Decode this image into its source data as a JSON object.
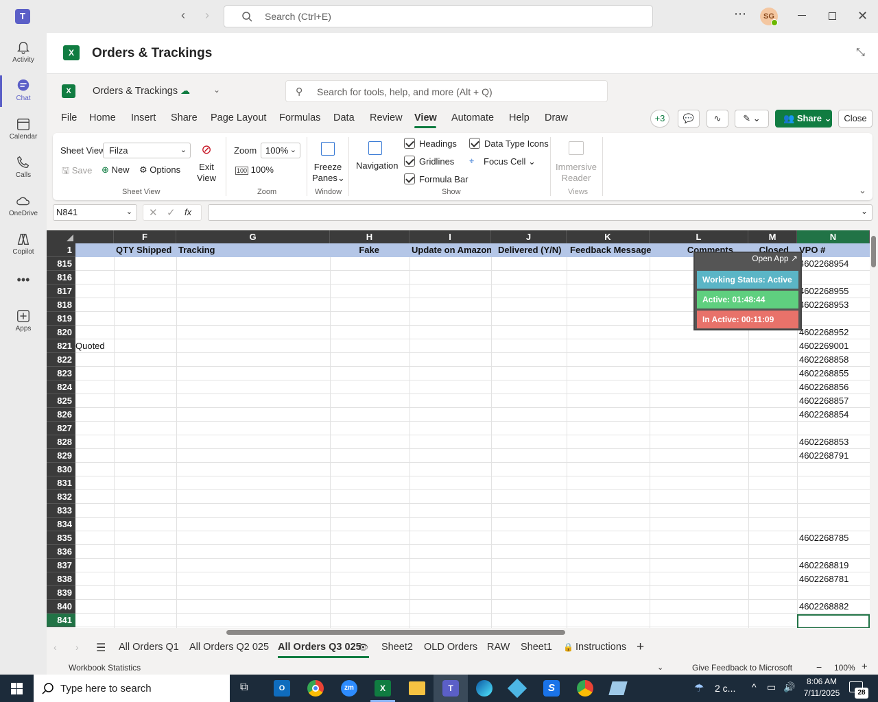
{
  "titlebar": {
    "search_placeholder": "Search (Ctrl+E)",
    "avatar_initials": "SG"
  },
  "rail": [
    {
      "label": "Activity",
      "icon": "bell-icon"
    },
    {
      "label": "Chat",
      "icon": "chat-icon"
    },
    {
      "label": "Calendar",
      "icon": "calendar-icon"
    },
    {
      "label": "Calls",
      "icon": "phone-icon"
    },
    {
      "label": "OneDrive",
      "icon": "cloud-icon"
    },
    {
      "label": "Copilot",
      "icon": "copilot-icon"
    },
    {
      "label": "",
      "icon": "more-icon"
    },
    {
      "label": "Apps",
      "icon": "add-apps-icon"
    }
  ],
  "app_header": {
    "title": "Orders & Trackings"
  },
  "excel": {
    "doc_name": "Orders & Trackings",
    "search_placeholder": "Search for tools, help, and more (Alt + Q)",
    "menu": [
      "File",
      "Home",
      "Insert",
      "Share",
      "Page Layout",
      "Formulas",
      "Data",
      "Review",
      "View",
      "Automate",
      "Help",
      "Draw"
    ],
    "active_menu": "View",
    "presence_count": "+3",
    "share_label": "Share",
    "close_label": "Close"
  },
  "ribbon": {
    "sheet_view_label": "Sheet View",
    "sheet_view_value": "Filza",
    "save": "Save",
    "new": "New",
    "options": "Options",
    "exit_view_1": "Exit",
    "exit_view_2": "View",
    "sheet_view_group": "Sheet View",
    "zoom_label": "Zoom",
    "zoom_value": "100%",
    "zoom_100": "100%",
    "zoom_group": "Zoom",
    "freeze_1": "Freeze",
    "freeze_2": "Panes",
    "window_group": "Window",
    "navigation": "Navigation",
    "headings": "Headings",
    "gridlines": "Gridlines",
    "formula_bar": "Formula Bar",
    "data_type_icons": "Data Type Icons",
    "focus_cell": "Focus Cell",
    "show_group": "Show",
    "immersive_1": "Immersive",
    "immersive_2": "Reader",
    "views_group": "Views"
  },
  "formula": {
    "name_box": "N841",
    "fx": "fx",
    "value": ""
  },
  "grid": {
    "columns": [
      "F",
      "G",
      "H",
      "I",
      "J",
      "K",
      "L",
      "M",
      "N"
    ],
    "header_row_num": "1",
    "headers": {
      "F": "QTY Shipped",
      "G": "Tracking",
      "H": "Fake",
      "I": "Update on Amazon",
      "J": "Delivered (Y/N)",
      "K": "Feedback Message",
      "L": "Comments",
      "M": "Closed",
      "N": "VPO #"
    },
    "rows": [
      {
        "num": "815",
        "n": "4602268954",
        "f": ""
      },
      {
        "num": "816",
        "n": "",
        "f": ""
      },
      {
        "num": "817",
        "n": "4602268955",
        "f": ""
      },
      {
        "num": "818",
        "n": "4602268953",
        "f": ""
      },
      {
        "num": "819",
        "n": "",
        "f": ""
      },
      {
        "num": "820",
        "n": "4602268952",
        "f": ""
      },
      {
        "num": "821",
        "n": "4602269001",
        "f": "Quoted"
      },
      {
        "num": "822",
        "n": "4602268858",
        "f": ""
      },
      {
        "num": "823",
        "n": "4602268855",
        "f": ""
      },
      {
        "num": "824",
        "n": "4602268856",
        "f": ""
      },
      {
        "num": "825",
        "n": "4602268857",
        "f": ""
      },
      {
        "num": "826",
        "n": "4602268854",
        "f": ""
      },
      {
        "num": "827",
        "n": "",
        "f": ""
      },
      {
        "num": "828",
        "n": "4602268853",
        "f": ""
      },
      {
        "num": "829",
        "n": "4602268791",
        "f": ""
      },
      {
        "num": "830",
        "n": "",
        "f": ""
      },
      {
        "num": "831",
        "n": "",
        "f": ""
      },
      {
        "num": "832",
        "n": "",
        "f": ""
      },
      {
        "num": "833",
        "n": "",
        "f": ""
      },
      {
        "num": "834",
        "n": "",
        "f": ""
      },
      {
        "num": "835",
        "n": "4602268785",
        "f": ""
      },
      {
        "num": "836",
        "n": "",
        "f": ""
      },
      {
        "num": "837",
        "n": "4602268819",
        "f": ""
      },
      {
        "num": "838",
        "n": "4602268781",
        "f": ""
      },
      {
        "num": "839",
        "n": "",
        "f": ""
      },
      {
        "num": "840",
        "n": "4602268882",
        "f": ""
      },
      {
        "num": "841",
        "n": "",
        "f": ""
      }
    ]
  },
  "widget": {
    "open_app": "Open App ↗",
    "status": "Working Status: Active",
    "active": "Active: 01:48:44",
    "inactive": "In Active: 00:11:09",
    "colors": {
      "status": "#5bb5c6",
      "active": "#5fcf7f",
      "inactive": "#e8726a"
    }
  },
  "tabs": [
    "All Orders Q1",
    "All Orders Q2 025",
    "All Orders Q3 025",
    "Sheet2",
    "OLD Orders",
    "RAW",
    "Sheet1",
    "Instructions"
  ],
  "active_tab": "All Orders Q3 025",
  "status": {
    "left": "Workbook Statistics",
    "feedback": "Give Feedback to Microsoft",
    "zoom": "100%"
  },
  "taskbar": {
    "search_placeholder": "Type here to search",
    "weather": "2 c...",
    "time": "8:06 AM",
    "date": "7/11/2025",
    "notifications": "28"
  }
}
